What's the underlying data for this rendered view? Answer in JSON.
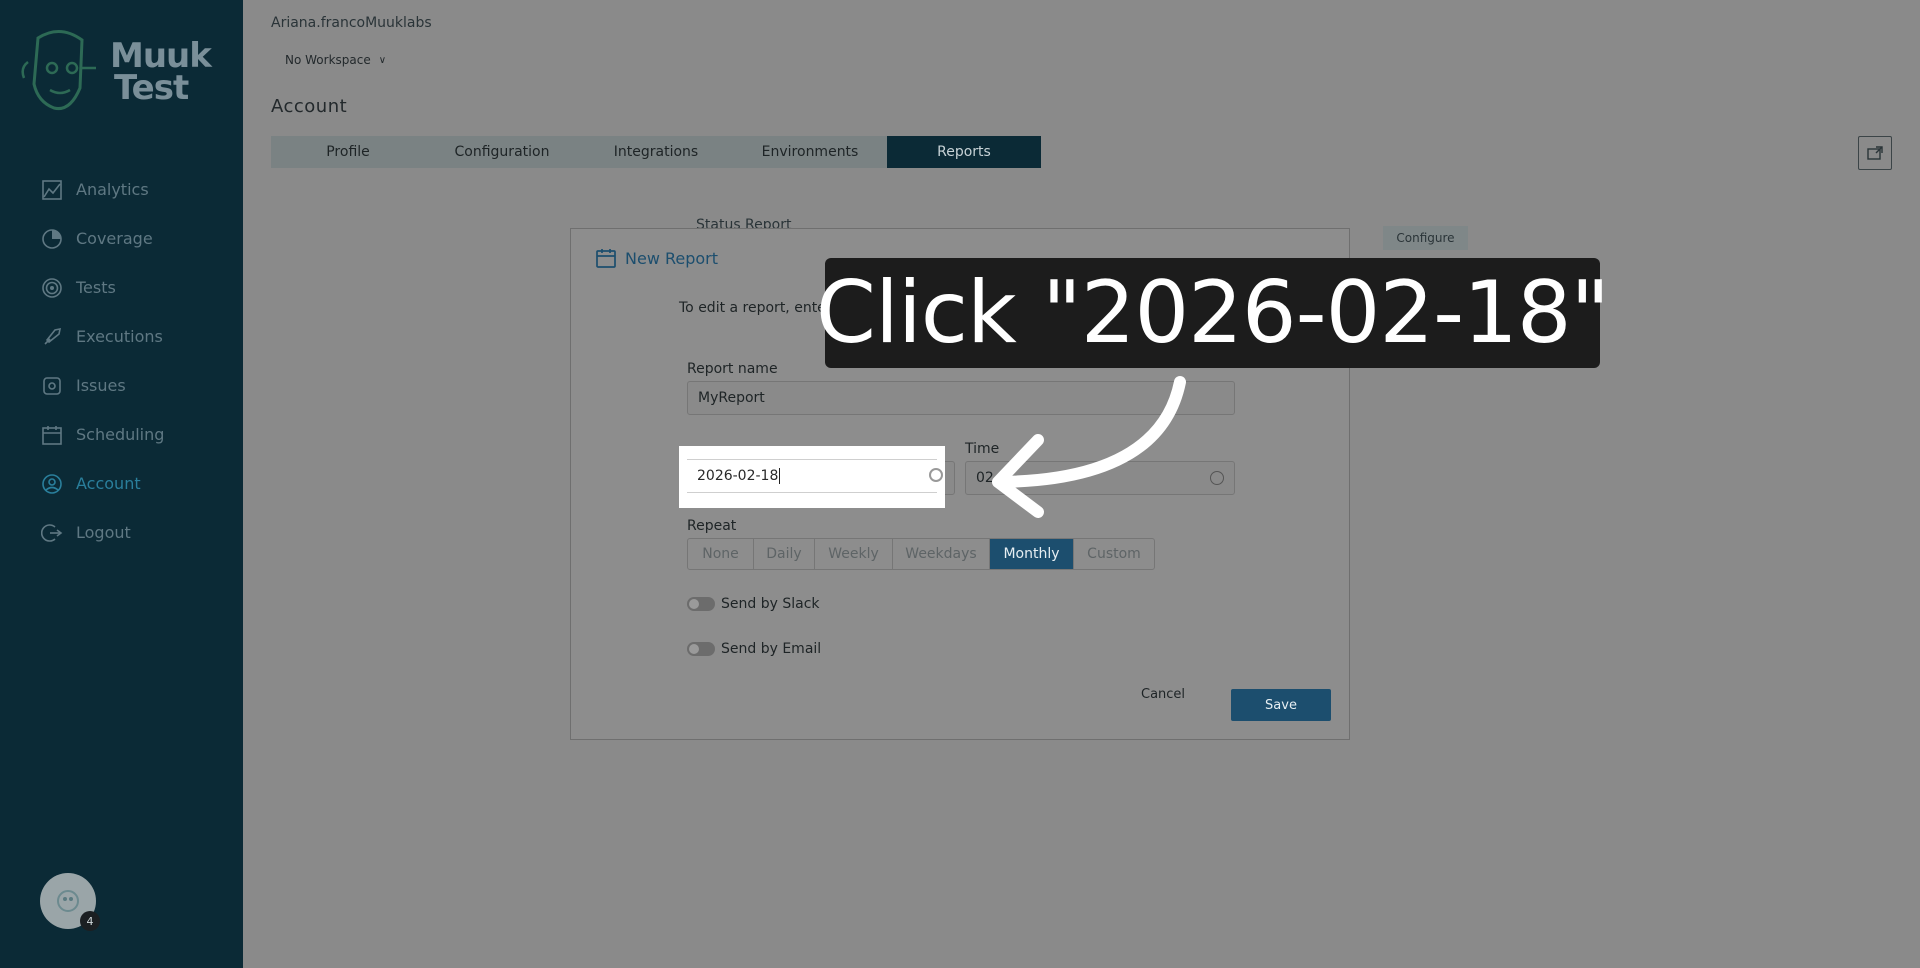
{
  "sidebar": {
    "logo_text_line1": "Muuk",
    "logo_text_line2": "Test",
    "items": [
      {
        "label": "Analytics",
        "icon": "analytics-icon"
      },
      {
        "label": "Coverage",
        "icon": "coverage-icon"
      },
      {
        "label": "Tests",
        "icon": "tests-icon"
      },
      {
        "label": "Executions",
        "icon": "executions-icon"
      },
      {
        "label": "Issues",
        "icon": "issues-icon"
      },
      {
        "label": "Scheduling",
        "icon": "calendar-icon"
      },
      {
        "label": "Account",
        "icon": "account-icon",
        "active": true
      },
      {
        "label": "Logout",
        "icon": "logout-icon"
      }
    ],
    "avatar_badge": "4"
  },
  "header": {
    "org": "Ariana.francoMuuklabs",
    "workspace": "No Workspace",
    "title": "Account"
  },
  "tabs": [
    {
      "label": "Profile"
    },
    {
      "label": "Configuration"
    },
    {
      "label": "Integrations"
    },
    {
      "label": "Environments"
    },
    {
      "label": "Reports",
      "active": true
    }
  ],
  "background": {
    "status_report": "Status Report",
    "configure": "Configure"
  },
  "modal": {
    "title": "New Report",
    "description": "To edit a report, enter its name, frequency, and the notification settings.",
    "report_name_label": "Report name",
    "report_name_value": "MyReport",
    "start_date_value": "2026-02-18",
    "time_label": "Time",
    "time_value": "02",
    "repeat_label": "Repeat",
    "repeat_options": [
      "None",
      "Daily",
      "Weekly",
      "Weekdays",
      "Monthly",
      "Custom"
    ],
    "repeat_selected": "Monthly",
    "send_by_slack": "Send by Slack",
    "send_by_email": "Send by Email",
    "cancel": "Cancel",
    "save": "Save"
  },
  "overlay": {
    "instruction": "Click \"2026-02-18\""
  },
  "colors": {
    "sidebar_bg": "#0b2a36",
    "accent": "#1c4e6e",
    "active_nav": "#2a7f9c"
  }
}
